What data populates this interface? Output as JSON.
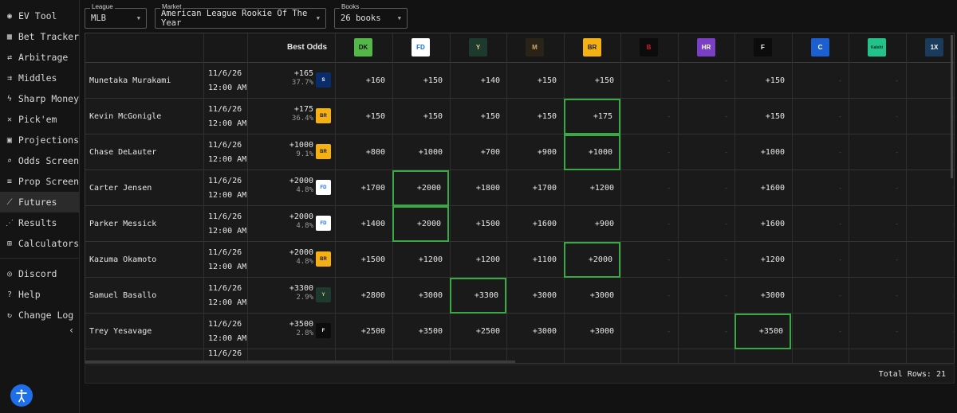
{
  "sidebar": {
    "items": [
      {
        "label": "EV Tool",
        "icon": "pin-icon",
        "glyph": "◉"
      },
      {
        "label": "Bet Tracker",
        "icon": "table-icon",
        "glyph": "▦"
      },
      {
        "label": "Arbitrage",
        "icon": "swap-icon",
        "glyph": "⇄"
      },
      {
        "label": "Middles",
        "icon": "split-arrows-icon",
        "glyph": "⇉"
      },
      {
        "label": "Sharp Money",
        "icon": "bolt-icon",
        "glyph": "ϟ"
      },
      {
        "label": "Pick'em",
        "icon": "tools-icon",
        "glyph": "✕"
      },
      {
        "label": "Projections",
        "icon": "calculator-box-icon",
        "glyph": "▣"
      },
      {
        "label": "Odds Screen",
        "icon": "search-icon",
        "glyph": "⌕"
      },
      {
        "label": "Prop Screen",
        "icon": "filter-lines-icon",
        "glyph": "≡"
      },
      {
        "label": "Futures",
        "icon": "trending-up-icon",
        "glyph": "⟋"
      },
      {
        "label": "Results",
        "icon": "scatter-icon",
        "glyph": "⋰"
      },
      {
        "label": "Calculators",
        "icon": "grid-calculator-icon",
        "glyph": "⊞"
      }
    ],
    "bottom_items": [
      {
        "label": "Discord",
        "icon": "discord-icon",
        "glyph": "◎"
      },
      {
        "label": "Help",
        "icon": "help-icon",
        "glyph": "?"
      },
      {
        "label": "Change Log",
        "icon": "history-icon",
        "glyph": "↻"
      }
    ],
    "active": "Futures",
    "collapse_glyph": "‹"
  },
  "filters": {
    "league": {
      "label": "League",
      "value": "MLB"
    },
    "market": {
      "label": "Market",
      "value": "American League Rookie Of The Year"
    },
    "books": {
      "label": "Books",
      "value": "26 books"
    }
  },
  "table": {
    "best_odds_header": "Best Odds",
    "books": [
      {
        "name": "DraftKings",
        "icon": "draftkings-logo-icon",
        "bg": "#53b848",
        "text": "DK",
        "fg": "#111"
      },
      {
        "name": "FanDuel",
        "icon": "fanduel-logo-icon",
        "bg": "#ffffff",
        "text": "FD",
        "fg": "#1a6ce3"
      },
      {
        "name": "Circa",
        "icon": "circa-logo-icon",
        "bg": "#1e3a2e",
        "text": "Y",
        "fg": "#e0c985"
      },
      {
        "name": "BetMGM",
        "icon": "betmgm-logo-icon",
        "bg": "#2a2418",
        "text": "M",
        "fg": "#c9a96b"
      },
      {
        "name": "BetRivers",
        "icon": "betrivers-logo-icon",
        "bg": "#f5b014",
        "text": "BR",
        "fg": "#1a1a1a"
      },
      {
        "name": "Bally Bet",
        "icon": "ballybet-logo-icon",
        "bg": "#0c0c0c",
        "text": "B",
        "fg": "#d0202a"
      },
      {
        "name": "Hard Rock",
        "icon": "hardrock-logo-icon",
        "bg": "#7a3fc4",
        "text": "HR",
        "fg": "#ffffff"
      },
      {
        "name": "Fanatics",
        "icon": "fanatics-logo-icon",
        "bg": "#0c0c0c",
        "text": "F",
        "fg": "#ffffff"
      },
      {
        "name": "Caesars",
        "icon": "caesars-logo-icon",
        "bg": "#1c5fd1",
        "text": "C",
        "fg": "#ffffff"
      },
      {
        "name": "Kalshi",
        "icon": "kalshi-logo-icon",
        "bg": "#22c28a",
        "text": "Kalshi",
        "fg": "#0c2e1e"
      },
      {
        "name": "1xBet",
        "icon": "1xbet-logo-icon",
        "bg": "#1b3b5c",
        "text": "1X",
        "fg": "#ffffff"
      }
    ],
    "rows": [
      {
        "player": "Munetaka Murakami",
        "date": "11/6/26",
        "time": "12:00 AM",
        "best_odds": "+165",
        "best_pct": "37.7%",
        "best_book": "espnbet",
        "best_book_bg": "#0a2c6b",
        "best_book_text": "S",
        "best_book_fg": "#ffffff",
        "odds": [
          "+160",
          "+150",
          "+140",
          "+150",
          "+150",
          "-",
          "-",
          "+150",
          "-",
          "-",
          "-"
        ],
        "highlight": -1
      },
      {
        "player": "Kevin McGonigle",
        "date": "11/6/26",
        "time": "12:00 AM",
        "best_odds": "+175",
        "best_pct": "36.4%",
        "best_book": "betrivers",
        "best_book_bg": "#f5b014",
        "best_book_text": "BR",
        "best_book_fg": "#1a1a1a",
        "odds": [
          "+150",
          "+150",
          "+150",
          "+150",
          "+175",
          "-",
          "-",
          "+150",
          "-",
          "-",
          "-"
        ],
        "highlight": 4
      },
      {
        "player": "Chase DeLauter",
        "date": "11/6/26",
        "time": "12:00 AM",
        "best_odds": "+1000",
        "best_pct": "9.1%",
        "best_book": "betrivers",
        "best_book_bg": "#f5b014",
        "best_book_text": "BR",
        "best_book_fg": "#1a1a1a",
        "odds": [
          "+800",
          "+1000",
          "+700",
          "+900",
          "+1000",
          "-",
          "-",
          "+1000",
          "-",
          "-",
          "-"
        ],
        "highlight": 4
      },
      {
        "player": "Carter Jensen",
        "date": "11/6/26",
        "time": "12:00 AM",
        "best_odds": "+2000",
        "best_pct": "4.8%",
        "best_book": "fanduel",
        "best_book_bg": "#ffffff",
        "best_book_text": "FD",
        "best_book_fg": "#1a6ce3",
        "odds": [
          "+1700",
          "+2000",
          "+1800",
          "+1700",
          "+1200",
          "-",
          "-",
          "+1600",
          "-",
          "-",
          "-"
        ],
        "highlight": 1
      },
      {
        "player": "Parker Messick",
        "date": "11/6/26",
        "time": "12:00 AM",
        "best_odds": "+2000",
        "best_pct": "4.8%",
        "best_book": "fanduel",
        "best_book_bg": "#ffffff",
        "best_book_text": "FD",
        "best_book_fg": "#1a6ce3",
        "odds": [
          "+1400",
          "+2000",
          "+1500",
          "+1600",
          "+900",
          "-",
          "-",
          "+1600",
          "-",
          "-",
          "-"
        ],
        "highlight": 1
      },
      {
        "player": "Kazuma Okamoto",
        "date": "11/6/26",
        "time": "12:00 AM",
        "best_odds": "+2000",
        "best_pct": "4.8%",
        "best_book": "betrivers",
        "best_book_bg": "#f5b014",
        "best_book_text": "BR",
        "best_book_fg": "#1a1a1a",
        "odds": [
          "+1500",
          "+1200",
          "+1200",
          "+1100",
          "+2000",
          "-",
          "-",
          "+1200",
          "-",
          "-",
          "-"
        ],
        "highlight": 4
      },
      {
        "player": "Samuel Basallo",
        "date": "11/6/26",
        "time": "12:00 AM",
        "best_odds": "+3300",
        "best_pct": "2.9%",
        "best_book": "circa",
        "best_book_bg": "#1e3a2e",
        "best_book_text": "Y",
        "best_book_fg": "#e0c985",
        "odds": [
          "+2800",
          "+3000",
          "+3300",
          "+3000",
          "+3000",
          "-",
          "-",
          "+3000",
          "-",
          "-",
          "-"
        ],
        "highlight": 2
      },
      {
        "player": "Trey Yesavage",
        "date": "11/6/26",
        "time": "12:00 AM",
        "best_odds": "+3500",
        "best_pct": "2.8%",
        "best_book": "fanatics",
        "best_book_bg": "#0c0c0c",
        "best_book_text": "F",
        "best_book_fg": "#ffffff",
        "odds": [
          "+2500",
          "+3500",
          "+2500",
          "+3000",
          "+3000",
          "-",
          "-",
          "+3500",
          "-",
          "-",
          "-"
        ],
        "highlight": 7
      }
    ],
    "partial_row_date": "11/6/26",
    "total_rows_label": "Total Rows: 21"
  },
  "colors": {
    "highlight": "#39a845",
    "background": "#121212",
    "accent": "#1f6feb"
  }
}
